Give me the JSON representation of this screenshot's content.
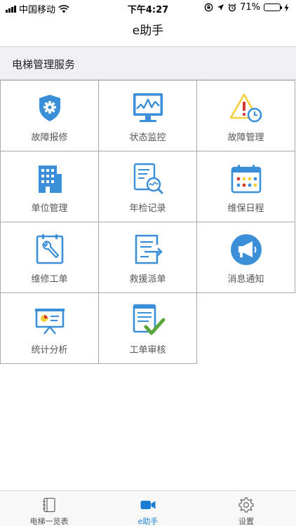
{
  "status_bar": {
    "carrier": "中国移动",
    "time": "下午4:27",
    "battery_percent": "71%",
    "battery_level": 0.71
  },
  "nav": {
    "title": "e助手"
  },
  "section": {
    "title": "电梯管理服务"
  },
  "grid": [
    {
      "label": "故障报修",
      "icon": "shield-gear-icon"
    },
    {
      "label": "状态监控",
      "icon": "monitor-chart-icon"
    },
    {
      "label": "故障管理",
      "icon": "warning-clock-icon"
    },
    {
      "label": "单位管理",
      "icon": "building-icon"
    },
    {
      "label": "年检记录",
      "icon": "document-magnifier-icon"
    },
    {
      "label": "维保日程",
      "icon": "calendar-icon"
    },
    {
      "label": "维修工单",
      "icon": "wrench-clipboard-icon"
    },
    {
      "label": "救援派单",
      "icon": "document-arrow-icon"
    },
    {
      "label": "消息通知",
      "icon": "megaphone-icon"
    },
    {
      "label": "统计分析",
      "icon": "presentation-board-icon"
    },
    {
      "label": "工单审核",
      "icon": "document-check-icon"
    }
  ],
  "tabs": [
    {
      "label": "电梯一览表",
      "icon": "notebook-icon",
      "active": false
    },
    {
      "label": "e助手",
      "icon": "video-camera-icon",
      "active": true
    },
    {
      "label": "设置",
      "icon": "gear-icon",
      "active": false
    }
  ],
  "colors": {
    "accent": "#1a7fd4",
    "icon_blue": "#3a8fd8",
    "warning_yellow": "#f3cf3a",
    "alert_red": "#d9362f",
    "check_green": "#5aa83a"
  }
}
